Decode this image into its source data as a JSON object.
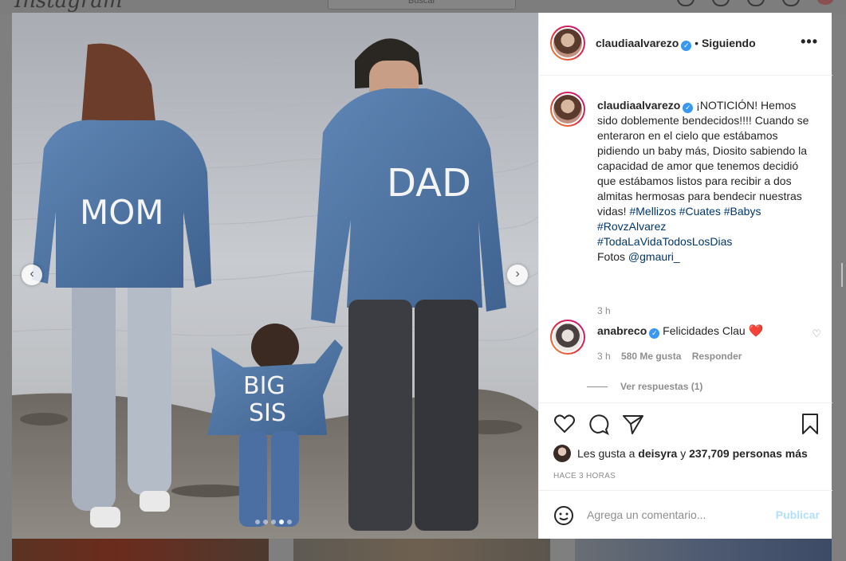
{
  "topbar": {
    "logo": "Instagram",
    "search_placeholder": "Buscar"
  },
  "post": {
    "image_alt": "MOM DAD BIG SIS",
    "jacket_mom": "MOM",
    "jacket_dad": "DAD",
    "jacket_sis_line1": "BIG",
    "jacket_sis_line2": "SIS",
    "carousel": {
      "total": 4,
      "active_index": 3
    }
  },
  "header": {
    "username": "claudiaalvarezo",
    "separator": "•",
    "follow_status": "Siguiendo",
    "more": "•••"
  },
  "caption": {
    "username": "claudiaalvarezo",
    "text_part1": "¡NOTICIÓN! Hemos sido doblemente bendecidos!!!! Cuando se enteraron en el cielo que estábamos pidiendo un baby más, Diosito sabiendo la capacidad de amor que tenemos decidió que estábamos listos para recibir a dos almitas hermosas para bendecir nuestras vidas! ",
    "hashtags": [
      "#Mellizos",
      "#Cuates",
      "#Babys",
      "#RovzAlvarez",
      "#TodaLaVidaTodosLosDias"
    ],
    "photos_label": "Fotos ",
    "photos_credit": "@gmauri_",
    "time": "3 h"
  },
  "comment": {
    "username": "anabreco",
    "text": "Felicidades Clau",
    "emoji": "❤️",
    "time": "3 h",
    "likes": "580 Me gusta",
    "reply": "Responder",
    "view_replies": "Ver respuestas (1)"
  },
  "likes": {
    "prefix": "Les gusta a ",
    "user": "deisyra",
    "connector": " y ",
    "count": "237,709 personas más"
  },
  "timestamp": "HACE 3 HORAS",
  "add_comment": {
    "placeholder": "Agrega un comentario...",
    "publish": "Publicar"
  },
  "colors": {
    "accent": "#3897f0",
    "hashtag": "#00376b",
    "publish_disabled": "#b2dffc",
    "heart": "#ed4956"
  }
}
